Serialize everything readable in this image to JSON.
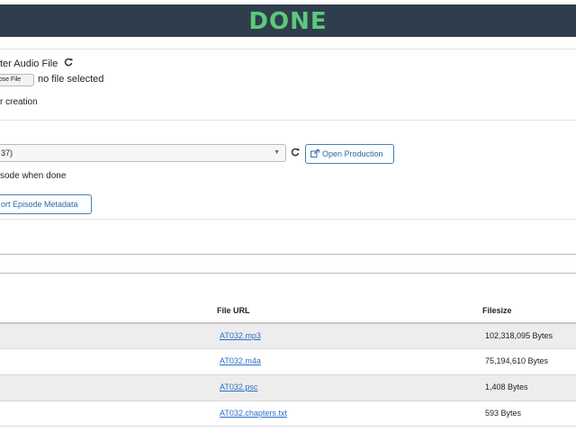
{
  "header": {
    "status_text": "DONE"
  },
  "upload": {
    "master_label": "ter Audio File",
    "choose_button": "oose File",
    "no_file_text": "no file selected",
    "creation_text": "r creation"
  },
  "production": {
    "selected_value": "37)",
    "open_button": "Open Production",
    "episode_done_text": "sode when done",
    "export_button": "ort Episode Metadata"
  },
  "files": {
    "headers": {
      "url": "File URL",
      "size": "Filesize"
    },
    "rows": [
      {
        "url": "AT032.mp3",
        "size": "102,318,095 Bytes"
      },
      {
        "url": "AT032.m4a",
        "size": "75,194,610 Bytes"
      },
      {
        "url": "AT032.psc",
        "size": "1,408 Bytes"
      },
      {
        "url": "AT032.chapters.txt",
        "size": "593 Bytes"
      }
    ]
  },
  "colors": {
    "topbar": "#2f3e4d",
    "done_text": "#5cc97a",
    "link": "#2a6fc9",
    "button_border": "#4a7fb3"
  },
  "icons": [
    "refresh-icon",
    "external-link-icon",
    "dropdown-arrow-icon"
  ]
}
